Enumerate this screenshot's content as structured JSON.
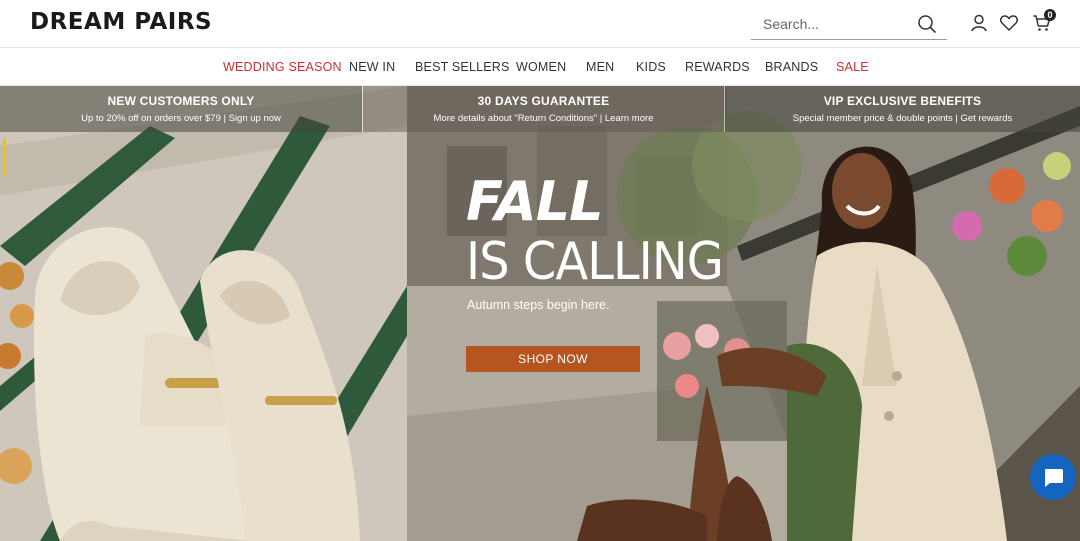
{
  "brand": {
    "logo_text": "DREAM PAIRS"
  },
  "search": {
    "placeholder": "Search..."
  },
  "header_icons": {
    "account": "user-icon",
    "wishlist": "heart-icon",
    "cart": "cart-icon",
    "cart_count": "0"
  },
  "nav": {
    "items": [
      {
        "label": "WEDDING SEASON",
        "highlight": true
      },
      {
        "label": "NEW IN"
      },
      {
        "label": "BEST SELLERS"
      },
      {
        "label": "WOMEN"
      },
      {
        "label": "MEN"
      },
      {
        "label": "KIDS"
      },
      {
        "label": "REWARDS"
      },
      {
        "label": "BRANDS"
      },
      {
        "label": "SALE",
        "highlight": true
      }
    ]
  },
  "promos": [
    {
      "title": "NEW CUSTOMERS ONLY",
      "subtitle": "Up to 20% off on orders over $79  |  Sign up now"
    },
    {
      "title": "30 DAYS GUARANTEE",
      "subtitle": "More details about \"Return Conditions\"  |  Learn more"
    },
    {
      "title": "VIP EXCLUSIVE BENEFITS",
      "subtitle": "Special member price & double points  |  Get rewards"
    }
  ],
  "hero": {
    "headline_1": "FALL",
    "headline_2": "IS CALLING",
    "subtext": "Autumn steps begin here.",
    "cta": "SHOP NOW"
  },
  "colors": {
    "accent_red": "#cf2e2e",
    "cta": "#b5551f",
    "chat": "#1565c0"
  }
}
